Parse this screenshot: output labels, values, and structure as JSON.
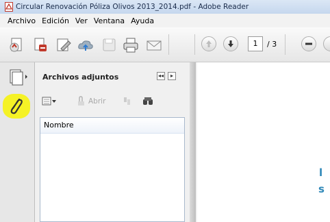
{
  "window": {
    "title": "Circular Renovación Póliza Olivos 2013_2014.pdf - Adobe Reader"
  },
  "menu": {
    "items": [
      "Archivo",
      "Edición",
      "Ver",
      "Ventana",
      "Ayuda"
    ]
  },
  "toolbar": {
    "icons": [
      "create-pdf-icon",
      "print-setup-icon",
      "edit-icon",
      "cloud-share-icon",
      "save-icon",
      "print-icon",
      "email-icon",
      "prev-page-icon",
      "next-page-icon",
      "zoom-out-icon"
    ],
    "page_current": "1",
    "page_total": "/ 3"
  },
  "left_nav": {
    "items": [
      "pages-icon",
      "attachment-icon"
    ],
    "highlight_color": "#f5f226"
  },
  "panel": {
    "title": "Archivos adjuntos",
    "tools": {
      "open_label": "Abrir"
    },
    "list": {
      "column_header": "Nombre"
    }
  },
  "document": {
    "visible_fragments": [
      "l",
      "s"
    ],
    "accent_color": "#2f88b8"
  }
}
